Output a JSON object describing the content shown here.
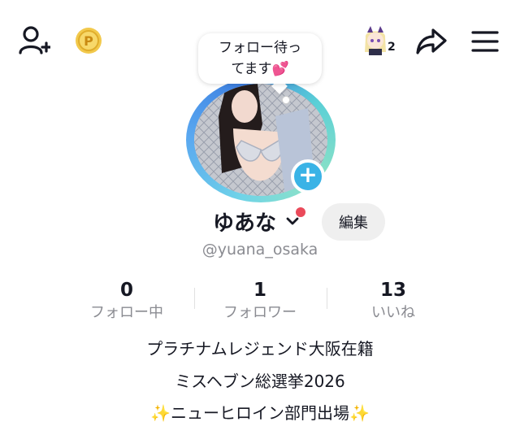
{
  "header": {
    "icons": [
      "add-friend-icon",
      "coin-icon",
      "creator-avatar-icon",
      "share-icon",
      "menu-icon"
    ],
    "avatar_badge_count": "2"
  },
  "bubble": {
    "line1": "フォロー待っ",
    "line2": "てます💕"
  },
  "profile": {
    "display_name": "ゆあな",
    "edit_label": "編集",
    "handle": "@yuana_osaka",
    "add_story_symbol": "+",
    "online_color": "#ea4a5a",
    "accent_color": "#3ab3e6"
  },
  "stats": [
    {
      "value": "0",
      "label": "フォロー中"
    },
    {
      "value": "1",
      "label": "フォロワー"
    },
    {
      "value": "13",
      "label": "いいね"
    }
  ],
  "bio": [
    "プラチナムレジェンド大阪在籍",
    "ミスヘブン総選挙2026",
    "✨ニューヒロイン部門出場✨"
  ]
}
